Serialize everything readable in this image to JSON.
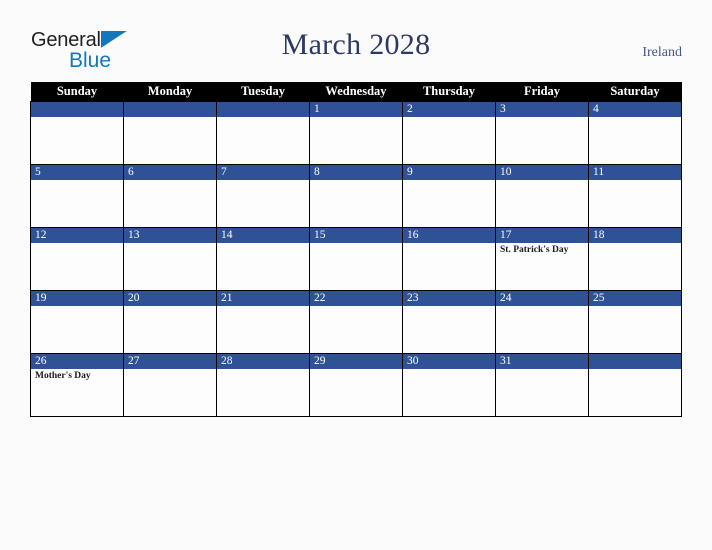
{
  "brand": {
    "name_part1": "General",
    "name_part2": "Blue",
    "color_dark": "#231f20",
    "color_blue": "#1278be"
  },
  "header": {
    "title": "March 2028",
    "country": "Ireland",
    "title_color": "#2b3a62",
    "country_color": "#44578a"
  },
  "calendar": {
    "accent_color": "#2e5295",
    "header_bg": "#000000",
    "weekdays": [
      "Sunday",
      "Monday",
      "Tuesday",
      "Wednesday",
      "Thursday",
      "Friday",
      "Saturday"
    ],
    "weeks": [
      [
        {
          "date": "",
          "events": []
        },
        {
          "date": "",
          "events": []
        },
        {
          "date": "",
          "events": []
        },
        {
          "date": "1",
          "events": []
        },
        {
          "date": "2",
          "events": []
        },
        {
          "date": "3",
          "events": []
        },
        {
          "date": "4",
          "events": []
        }
      ],
      [
        {
          "date": "5",
          "events": []
        },
        {
          "date": "6",
          "events": []
        },
        {
          "date": "7",
          "events": []
        },
        {
          "date": "8",
          "events": []
        },
        {
          "date": "9",
          "events": []
        },
        {
          "date": "10",
          "events": []
        },
        {
          "date": "11",
          "events": []
        }
      ],
      [
        {
          "date": "12",
          "events": []
        },
        {
          "date": "13",
          "events": []
        },
        {
          "date": "14",
          "events": []
        },
        {
          "date": "15",
          "events": []
        },
        {
          "date": "16",
          "events": []
        },
        {
          "date": "17",
          "events": [
            "St. Patrick's Day"
          ]
        },
        {
          "date": "18",
          "events": []
        }
      ],
      [
        {
          "date": "19",
          "events": []
        },
        {
          "date": "20",
          "events": []
        },
        {
          "date": "21",
          "events": []
        },
        {
          "date": "22",
          "events": []
        },
        {
          "date": "23",
          "events": []
        },
        {
          "date": "24",
          "events": []
        },
        {
          "date": "25",
          "events": []
        }
      ],
      [
        {
          "date": "26",
          "events": [
            "Mother's Day"
          ]
        },
        {
          "date": "27",
          "events": []
        },
        {
          "date": "28",
          "events": []
        },
        {
          "date": "29",
          "events": []
        },
        {
          "date": "30",
          "events": []
        },
        {
          "date": "31",
          "events": []
        },
        {
          "date": "",
          "events": []
        }
      ]
    ]
  }
}
